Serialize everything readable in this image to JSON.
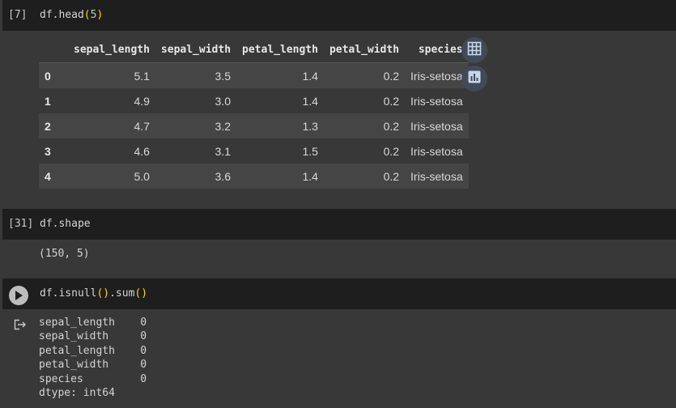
{
  "cells": [
    {
      "count": "[7]",
      "code": {
        "pre": "df.head",
        "open": "(",
        "arg": "5",
        "close": ")"
      },
      "table": {
        "columns": [
          "",
          "sepal_length",
          "sepal_width",
          "petal_length",
          "petal_width",
          "species"
        ],
        "rows": [
          [
            "0",
            "5.1",
            "3.5",
            "1.4",
            "0.2",
            "Iris-setosa"
          ],
          [
            "1",
            "4.9",
            "3.0",
            "1.4",
            "0.2",
            "Iris-setosa"
          ],
          [
            "2",
            "4.7",
            "3.2",
            "1.3",
            "0.2",
            "Iris-setosa"
          ],
          [
            "3",
            "4.6",
            "3.1",
            "1.5",
            "0.2",
            "Iris-setosa"
          ],
          [
            "4",
            "5.0",
            "3.6",
            "1.4",
            "0.2",
            "Iris-setosa"
          ]
        ]
      },
      "buttons": {
        "table_icon": "table-icon",
        "chart_icon": "bar-chart-icon"
      }
    },
    {
      "count": "[31]",
      "code": "df.shape",
      "output": "(150, 5)"
    },
    {
      "run_icon": "play-icon",
      "code": {
        "pre": "df.isnull",
        "p1": "()",
        "mid": ".sum",
        "p2": "()"
      },
      "output_icon": "output-redirect-icon",
      "output": [
        "sepal_length    0",
        "sepal_width     0",
        "petal_length    0",
        "petal_width     0",
        "species         0",
        "dtype: int64"
      ]
    }
  ],
  "colors": {
    "editor_bg": "#1e1e1e",
    "page_bg": "#383838",
    "row_alt": "#454545",
    "bracket": "#ffd700",
    "bracket_inner": "#da70d6",
    "number": "#b5cea8"
  }
}
